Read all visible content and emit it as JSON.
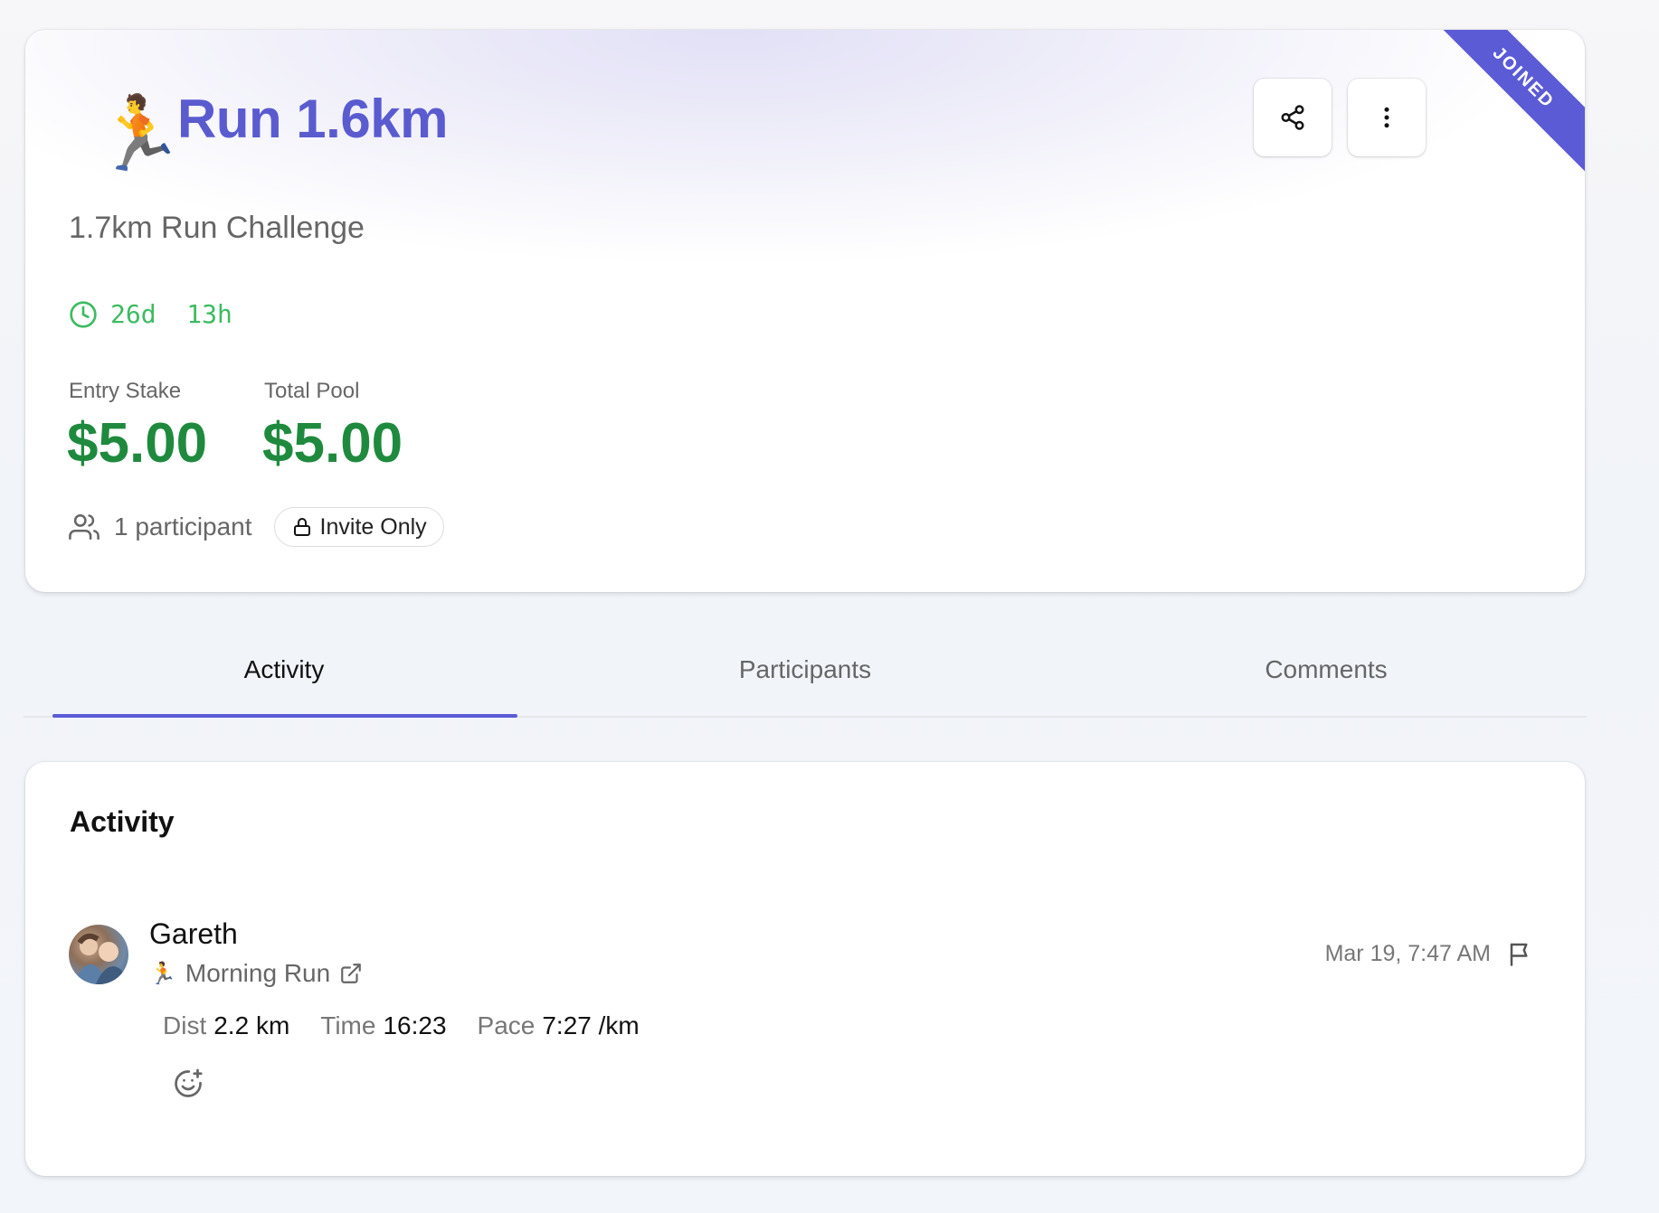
{
  "challenge": {
    "emoji": "🏃",
    "title": "Run 1.6km",
    "subtitle": "1.7km Run Challenge",
    "ribbon": "JOINED",
    "time_remaining": "26d  13h",
    "entry_stake_label": "Entry Stake",
    "entry_stake_value": "$5.00",
    "total_pool_label": "Total Pool",
    "total_pool_value": "$5.00",
    "participants": "1 participant",
    "visibility": "Invite Only",
    "accent": "#5b5bd6",
    "money_color": "#1f8a3e"
  },
  "tabs": [
    {
      "label": "Activity",
      "active": true
    },
    {
      "label": "Participants",
      "active": false
    },
    {
      "label": "Comments",
      "active": false
    }
  ],
  "activity": {
    "heading": "Activity",
    "entries": [
      {
        "user": "Gareth",
        "workout_emoji": "🏃",
        "workout": "Morning Run",
        "timestamp": "Mar 19, 7:47 AM",
        "dist_label": "Dist",
        "dist_value": "2.2 km",
        "time_label": "Time",
        "time_value": "16:23",
        "pace_label": "Pace",
        "pace_value": "7:27 /km"
      }
    ]
  }
}
